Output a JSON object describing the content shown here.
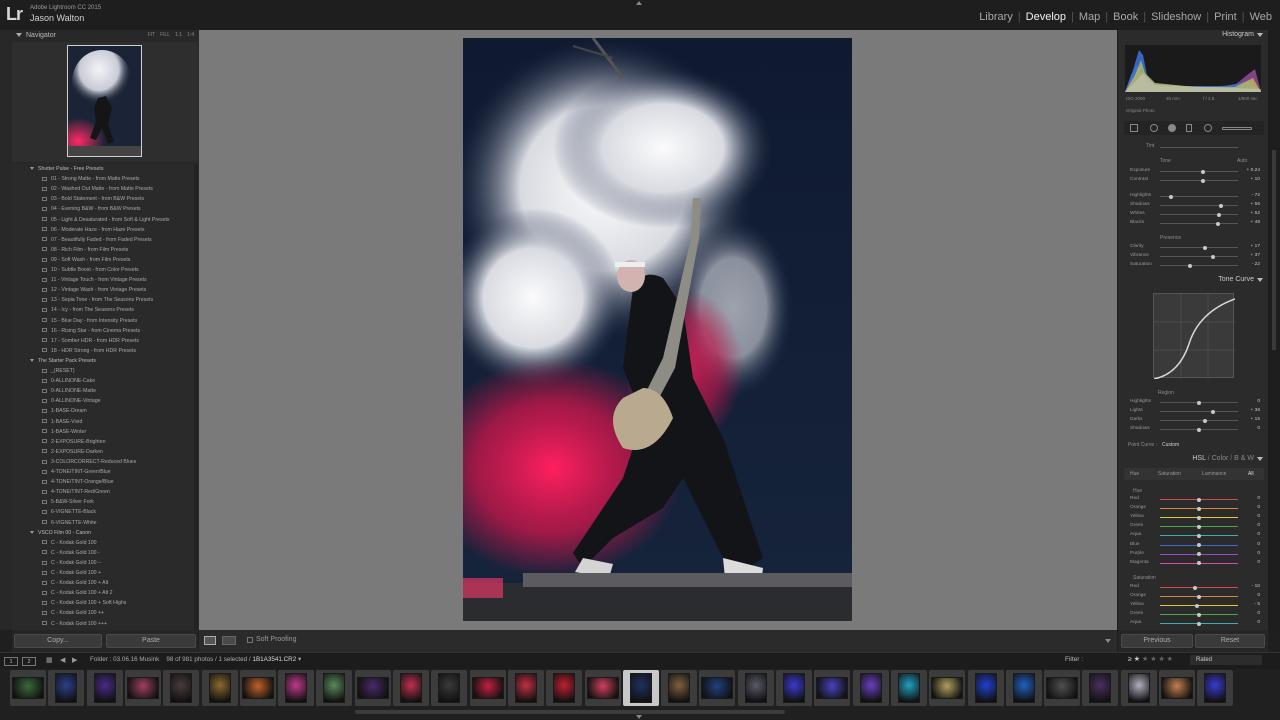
{
  "app": {
    "logo": "Lr",
    "name": "Adobe Lightroom CC 2015",
    "user": "Jason Walton"
  },
  "modules": [
    {
      "label": "Library",
      "active": false
    },
    {
      "label": "Develop",
      "active": true
    },
    {
      "label": "Map",
      "active": false
    },
    {
      "label": "Book",
      "active": false
    },
    {
      "label": "Slideshow",
      "active": false
    },
    {
      "label": "Print",
      "active": false
    },
    {
      "label": "Web",
      "active": false
    }
  ],
  "navigator": {
    "title": "Navigator",
    "options": [
      "FIT",
      "FILL",
      "1:1",
      "1:4"
    ]
  },
  "presets": [
    {
      "label": "Shutter Pulse - Free Presets",
      "folder": true
    },
    {
      "label": "01 - Strong Matte - from Matte Presets"
    },
    {
      "label": "02 - Washed Out Matte - from Matte Presets"
    },
    {
      "label": "03 - Bold Statement - from B&W Presets"
    },
    {
      "label": "04 - Evening B&W - from B&W Presets"
    },
    {
      "label": "05 - Light & Desaturated - from Soft & Light Presets"
    },
    {
      "label": "06 - Moderate Haze - from Haze Presets"
    },
    {
      "label": "07 - Beautifully Faded - from Faded Presets"
    },
    {
      "label": "08 - Rich Film - from Film Presets"
    },
    {
      "label": "09 - Soft Wash - from Film Presets"
    },
    {
      "label": "10 - Subtle Boost - from Color Presets"
    },
    {
      "label": "11 - Vintage Touch - from Vintage Presets"
    },
    {
      "label": "12 - Vintage Wash - from Vintage Presets"
    },
    {
      "label": "13 - Sepia Tone - from The Seasons Presets"
    },
    {
      "label": "14 - Icy - from The Seasons Presets"
    },
    {
      "label": "15 - Blue Day - from Intensity Presets"
    },
    {
      "label": "16 - Rising Star - from Cinema Presets"
    },
    {
      "label": "17 - Somber HDR - from HDR Presets"
    },
    {
      "label": "18 - HDR Strong - from HDR Presets"
    },
    {
      "label": "The Starter Pack Presets",
      "folder": true
    },
    {
      "label": "_(RESET)"
    },
    {
      "label": "0-ALLINONE-Cake"
    },
    {
      "label": "0-ALLINONE-Matte"
    },
    {
      "label": "0-ALLINONE-Vintage"
    },
    {
      "label": "1-BASE-Dream"
    },
    {
      "label": "1-BASE-Vivid"
    },
    {
      "label": "1-BASE-Winter"
    },
    {
      "label": "2-EXPOSURE-Brighten"
    },
    {
      "label": "2-EXPOSURE-Darken"
    },
    {
      "label": "3-COLORCORRECT-Reduced Blues"
    },
    {
      "label": "4-TONE/TINT-Green/Blue"
    },
    {
      "label": "4-TONE/TINT-Orange/Blue"
    },
    {
      "label": "4-TONE/TINT-Red/Green"
    },
    {
      "label": "5-B&W-Silver Fork"
    },
    {
      "label": "6-VIGNETTE-Black"
    },
    {
      "label": "6-VIGNETTE-White"
    },
    {
      "label": "VSCO Film 00 - Canon",
      "folder": true
    },
    {
      "label": "C - Kodak Gold 100"
    },
    {
      "label": "C - Kodak Gold 100 -"
    },
    {
      "label": "C - Kodak Gold 100 --"
    },
    {
      "label": "C - Kodak Gold 100 +"
    },
    {
      "label": "C - Kodak Gold 100 + Alt"
    },
    {
      "label": "C - Kodak Gold 100 + Alt 2"
    },
    {
      "label": "C - Kodak Gold 100 + Soft Highs"
    },
    {
      "label": "C - Kodak Gold 100 ++"
    },
    {
      "label": "C - Kodak Gold 100 +++"
    }
  ],
  "left_buttons": {
    "copy": "Copy...",
    "paste": "Paste"
  },
  "toolbar": {
    "soft_proofing": "Soft Proofing"
  },
  "histogram": {
    "title": "Histogram",
    "iso": "ISO 2000",
    "focal": "35 mm",
    "aperture": "f / 2.8",
    "shutter": "1/800 sec",
    "original_photo": "Original Photo"
  },
  "basic": {
    "tint_label": "Tint",
    "tone_label": "Tone",
    "auto_label": "Auto",
    "presence_label": "Presence",
    "sliders": [
      {
        "label": "Exposure",
        "value": "+ 0.24",
        "pos": 0.55
      },
      {
        "label": "Contrast",
        "value": "+ 10",
        "pos": 0.55
      },
      {
        "label": "Highlights",
        "value": "- 72",
        "pos": 0.14
      },
      {
        "label": "Shadows",
        "value": "+ 56",
        "pos": 0.78
      },
      {
        "label": "Whites",
        "value": "+ 52",
        "pos": 0.76
      },
      {
        "label": "Blacks",
        "value": "+ 48",
        "pos": 0.74
      }
    ],
    "presence": [
      {
        "label": "Clarity",
        "value": "+ 17",
        "pos": 0.58
      },
      {
        "label": "Vibrance",
        "value": "+ 37",
        "pos": 0.68
      },
      {
        "label": "Saturation",
        "value": "- 22",
        "pos": 0.39
      }
    ]
  },
  "tone_curve": {
    "title": "Tone Curve",
    "region_label": "Region",
    "point_curve_label": "Point Curve :",
    "point_curve_value": "Custom",
    "sliders": [
      {
        "label": "Highlights",
        "value": "0",
        "pos": 0.5
      },
      {
        "label": "Lights",
        "value": "+ 36",
        "pos": 0.68
      },
      {
        "label": "Darks",
        "value": "+ 15",
        "pos": 0.58
      },
      {
        "label": "Shadows",
        "value": "0",
        "pos": 0.5
      }
    ]
  },
  "hsl": {
    "tabs": [
      "HSL",
      "Color",
      "B & W"
    ],
    "subtabs": [
      "Hue",
      "Saturation",
      "Luminance",
      "All"
    ],
    "hue_label": "Hue",
    "saturation_label": "Saturation",
    "hue": [
      {
        "label": "Red",
        "value": "0",
        "pos": 0.5
      },
      {
        "label": "Orange",
        "value": "0",
        "pos": 0.5
      },
      {
        "label": "Yellow",
        "value": "0",
        "pos": 0.5
      },
      {
        "label": "Green",
        "value": "0",
        "pos": 0.5
      },
      {
        "label": "Aqua",
        "value": "0",
        "pos": 0.5
      },
      {
        "label": "Blue",
        "value": "0",
        "pos": 0.5
      },
      {
        "label": "Purple",
        "value": "0",
        "pos": 0.5
      },
      {
        "label": "Magenta",
        "value": "0",
        "pos": 0.5
      }
    ],
    "saturation": [
      {
        "label": "Red",
        "value": "- 10",
        "pos": 0.45
      },
      {
        "label": "Orange",
        "value": "0",
        "pos": 0.5
      },
      {
        "label": "Yellow",
        "value": "- 5",
        "pos": 0.47
      },
      {
        "label": "Green",
        "value": "0",
        "pos": 0.5
      },
      {
        "label": "Aqua",
        "value": "0",
        "pos": 0.5
      }
    ]
  },
  "right_buttons": {
    "previous": "Previous",
    "reset": "Reset"
  },
  "filmstrip_bar": {
    "page1": "1",
    "page2": "2",
    "folder": "Folder : 03.06.16 Musink",
    "count": "98 of 981 photos / 1 selected /",
    "filename": "1B1A3541.CR2",
    "filter": "Filter :",
    "rated": "Rated"
  },
  "colors": {
    "accent_pink": "#e8255e",
    "panel": "#2b2b2b",
    "canvas": "#7a7a7a"
  }
}
